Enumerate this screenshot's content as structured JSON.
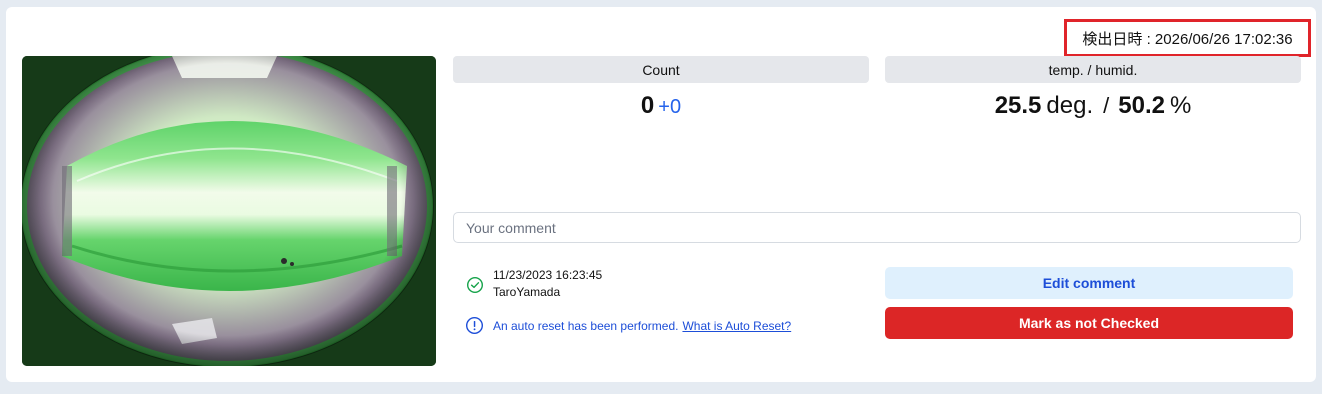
{
  "detection": {
    "label": "検出日時 : 2026/06/26 17:02:36"
  },
  "camera": {
    "alt": "fisheye camera view of illuminated trap"
  },
  "count": {
    "header": "Count",
    "value": "0",
    "delta": "+0"
  },
  "climate": {
    "header": "temp. / humid.",
    "temp": "25.5",
    "temp_unit": "deg.",
    "separator": "/",
    "humid": "50.2",
    "humid_unit": "%"
  },
  "comment": {
    "placeholder": "Your comment",
    "value": ""
  },
  "check_record": {
    "datetime": "11/23/2023 16:23:45",
    "user": "TaroYamada"
  },
  "auto_reset": {
    "message": "An auto reset has been performed.",
    "link": "What is Auto Reset?"
  },
  "actions": {
    "edit_label": "Edit comment",
    "mark_label": "Mark as not Checked"
  },
  "colors": {
    "accent": "#1d4ed8",
    "danger": "#dc2626",
    "success": "#16a34a",
    "highlight": "#e0242a"
  }
}
